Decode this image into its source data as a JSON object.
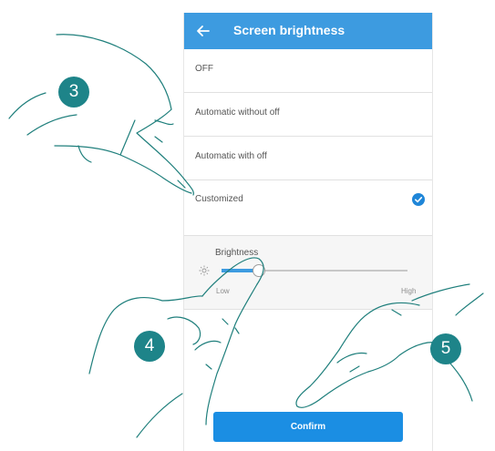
{
  "appbar": {
    "title": "Screen brightness",
    "back_icon": "arrow-left-icon",
    "color": "#3d9be0"
  },
  "options": [
    {
      "label": "OFF",
      "selected": false
    },
    {
      "label": "Automatic without off",
      "selected": false
    },
    {
      "label": "Automatic with off",
      "selected": false
    },
    {
      "label": "Customized",
      "selected": true
    }
  ],
  "brightness": {
    "title": "Brightness",
    "icon": "sun-icon",
    "value_fraction": 0.2,
    "min_label": "Low",
    "max_label": "High"
  },
  "confirm_label": "Confirm",
  "steps": [
    "3",
    "4",
    "5"
  ],
  "colors": {
    "accent": "#3d9be0",
    "confirm": "#1b8ee3",
    "step_badge": "#1e8489"
  }
}
